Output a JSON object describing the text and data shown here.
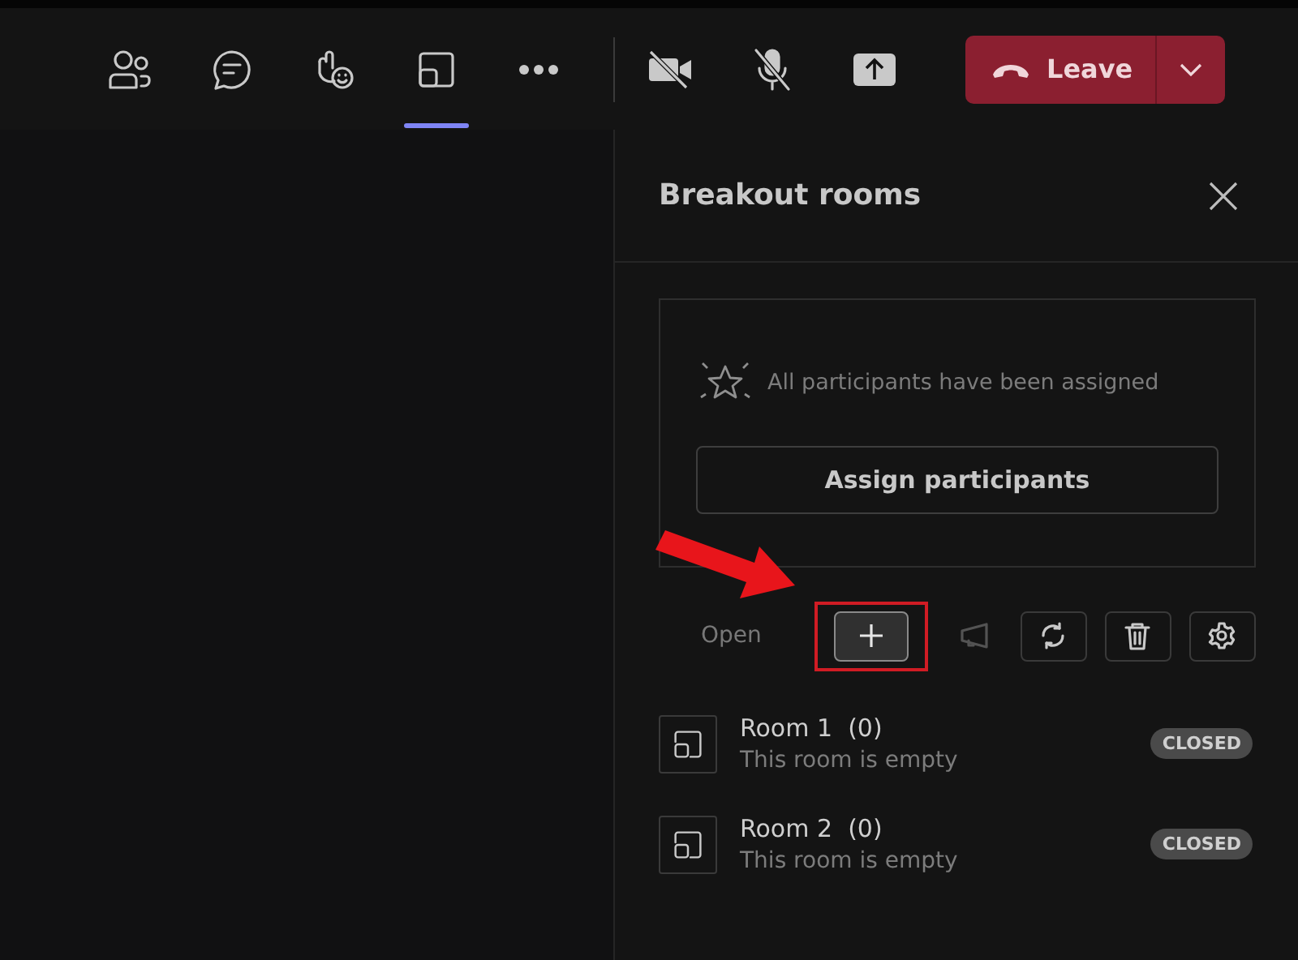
{
  "toolbar": {
    "items": [
      {
        "kind": "people",
        "selected": false
      },
      {
        "kind": "chat",
        "selected": false
      },
      {
        "kind": "react",
        "selected": false
      },
      {
        "kind": "rooms",
        "selected": true
      },
      {
        "kind": "more",
        "selected": false
      }
    ],
    "controls": [
      {
        "kind": "camera",
        "on": false
      },
      {
        "kind": "mic",
        "on": false
      },
      {
        "kind": "share",
        "on": false
      }
    ],
    "leave": {
      "label": "Leave"
    }
  },
  "panel": {
    "title": "Breakout rooms",
    "card": {
      "message": "All participants have been assigned",
      "button": "Assign participants"
    },
    "actions": [
      {
        "kind": "text",
        "label": "Open",
        "disabled": true
      },
      {
        "kind": "add",
        "disabled": false,
        "highlighted": true
      },
      {
        "kind": "announce",
        "disabled": true
      },
      {
        "kind": "recreate",
        "disabled": false
      },
      {
        "kind": "delete",
        "disabled": false
      },
      {
        "kind": "settings",
        "disabled": false
      }
    ],
    "rooms": [
      {
        "name": "Room 1  (0)",
        "subtitle": "This room is empty",
        "status": "CLOSED"
      },
      {
        "name": "Room 2  (0)",
        "subtitle": "This room is empty",
        "status": "CLOSED"
      }
    ]
  }
}
